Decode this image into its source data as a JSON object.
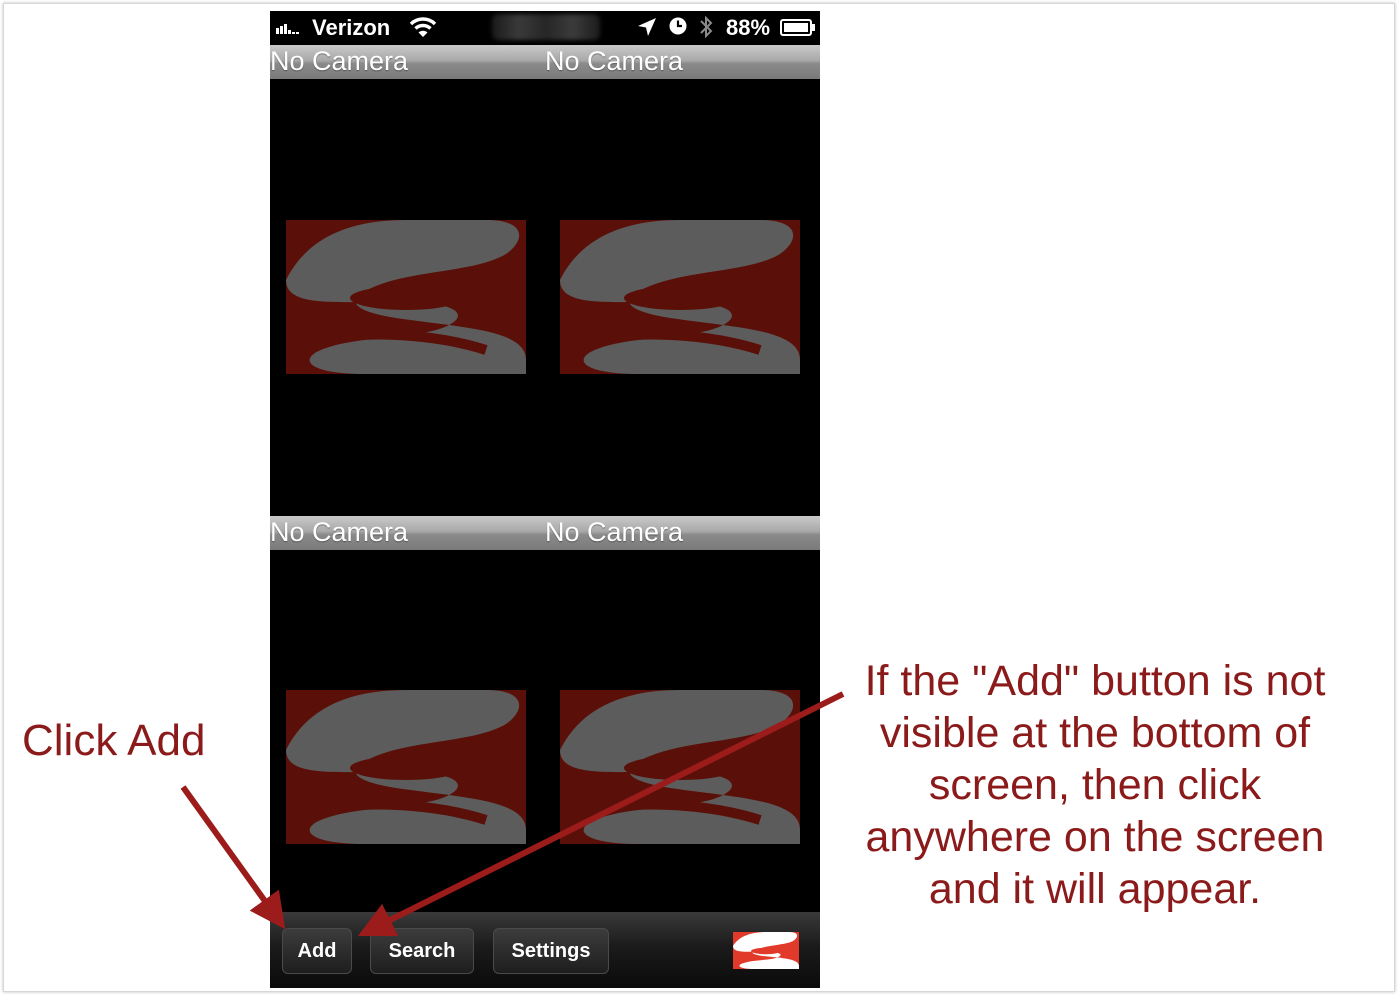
{
  "status_bar": {
    "signal": "ııı..",
    "carrier": "Verizon",
    "battery_percent": "88%",
    "wifi_icon": "wifi-icon",
    "location_icon": "location-arrow-icon",
    "clock_icon": "clock-icon",
    "bluetooth_icon": "bluetooth-icon",
    "battery_icon": "battery-icon"
  },
  "cameras": [
    {
      "label": "No Camera"
    },
    {
      "label": "No Camera"
    },
    {
      "label": "No Camera"
    },
    {
      "label": "No Camera"
    }
  ],
  "toolbar": {
    "add_label": "Add",
    "search_label": "Search",
    "settings_label": "Settings"
  },
  "annotations": {
    "left": "Click Add",
    "right_lines": [
      "If the \"Add\" button is not",
      "visible at the bottom of",
      "screen, then click",
      "anywhere on the screen",
      "and it will appear."
    ]
  },
  "colors": {
    "annotation": "#8b1a1a",
    "placeholder_bg": "#5a1008",
    "placeholder_shape": "#5c5c5c",
    "brand_red": "#e23a2a"
  }
}
